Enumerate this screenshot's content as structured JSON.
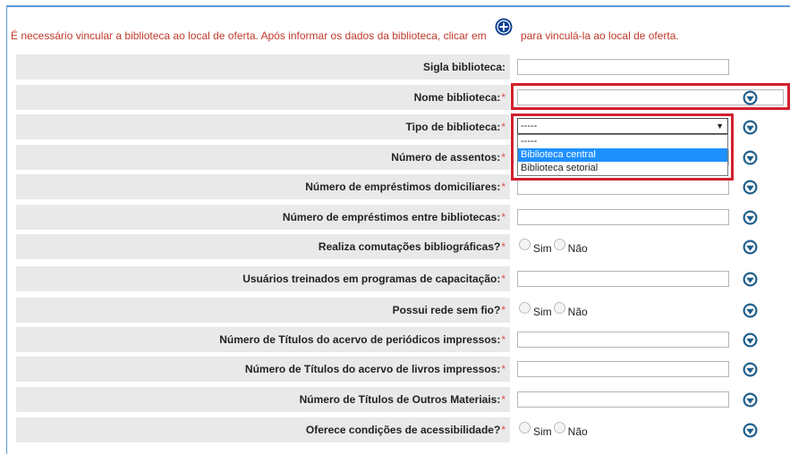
{
  "notice": {
    "text_before": "É necessário vincular a biblioteca ao local de oferta. Após informar os dados da biblioteca, clicar em",
    "text_after": "para vinculá-la ao local de oferta."
  },
  "required_marker": "*",
  "fields": [
    {
      "label": "Sigla biblioteca:",
      "required": "",
      "type": "text",
      "value": ""
    },
    {
      "label": "Nome biblioteca:",
      "required": "*",
      "type": "text",
      "value": ""
    },
    {
      "label": "Tipo de biblioteca:",
      "required": "*",
      "type": "select",
      "value": "-----"
    },
    {
      "label": "Número de assentos:",
      "required": "*",
      "type": "text",
      "value": ""
    },
    {
      "label": "Número de empréstimos domiciliares:",
      "required": "*",
      "type": "text",
      "value": ""
    },
    {
      "label": "Número de empréstimos entre bibliotecas:",
      "required": "*",
      "type": "text",
      "value": ""
    },
    {
      "label": "Realiza comutações bibliográficas?",
      "required": "*",
      "type": "radio",
      "value": ""
    },
    {
      "label": "Usuários treinados em programas de capacitação:",
      "required": "*",
      "type": "text",
      "value": ""
    },
    {
      "label": "Possui rede sem fio?",
      "required": "*",
      "type": "radio",
      "value": ""
    },
    {
      "label": "Número de Títulos do acervo de periódicos impressos:",
      "required": "*",
      "type": "text",
      "value": ""
    },
    {
      "label": "Número de Títulos do acervo de livros impressos:",
      "required": "*",
      "type": "text",
      "value": ""
    },
    {
      "label": "Número de Títulos de Outros Materiais:",
      "required": "*",
      "type": "text",
      "value": ""
    },
    {
      "label": "Oferece condições de acessibilidade?",
      "required": "*",
      "type": "radio",
      "value": ""
    }
  ],
  "radio_options": {
    "yes": "Sim",
    "no": "Não"
  },
  "select_dropdown": {
    "selected": "-----",
    "options": [
      "-----",
      "Biblioteca central",
      "Biblioteca setorial"
    ],
    "highlighted": "Biblioteca central"
  },
  "icons": {
    "add": "plus-circle-icon",
    "help": "help-drop-icon"
  },
  "colors": {
    "notice": "#c0392b",
    "required": "#d9534f",
    "highlight_box": "#d2202f",
    "option_highlight": "#1e90ff",
    "icon": "#1f5f8b"
  }
}
